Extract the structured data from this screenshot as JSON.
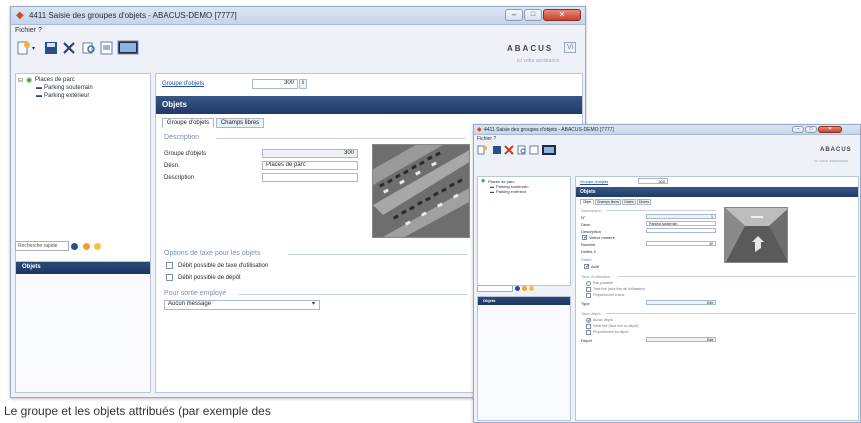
{
  "window1": {
    "title": "4411 Saisie des groupes d'objets - ABACUS-DEMO [7777]",
    "menu": "Fichier  ?",
    "brand": "ABACUS",
    "brand_suffix": "Vi",
    "help_link": "Ici votre assistance",
    "tree": {
      "root": "Places de parc",
      "children": [
        "Parking souterrain",
        "Parking extérieur"
      ]
    },
    "search_placeholder": "Recherche rapide",
    "objects_panel_title": "Objets",
    "group_field_label": "Groupe d'objets",
    "group_field_value": "300",
    "section_title": "Objets",
    "tabs": [
      "Groupe d'objets",
      "Champs libres"
    ],
    "description_group": "Description",
    "fields": [
      {
        "label": "Groupe d'objets",
        "value": "300"
      },
      {
        "label": "Désn.",
        "value": "Places de parc"
      },
      {
        "label": "Description",
        "value": ""
      }
    ],
    "tax_options_group": "Options de taxe pour les objets",
    "checkboxes": [
      "Débit possible de taxe d'utilisation",
      "Débit possible de dépôt"
    ],
    "exit_group": "Pour sortie employé",
    "exit_value": "Aucun message"
  },
  "window2": {
    "title": "4411 Saisie des groupes d'objets - ABACUS-DEMO [7777]",
    "menu": "Fichier  ?",
    "brand": "ABACUS",
    "help_link": "Ici votre assistance",
    "tree": {
      "root": "Places de parc",
      "children": [
        "Parking souterrain",
        "Parking extérieur"
      ]
    },
    "objects_panel_title": "Objets",
    "group_field_label": "Groupe d'objets",
    "group_field_value": "300",
    "section_title": "Objets",
    "tabs": [
      "Objet",
      "Champs libres",
      "Dates",
      "Divers"
    ],
    "description_group": "Description",
    "fields": [
      {
        "label": "N°",
        "value": "1"
      },
      {
        "label": "Désn.",
        "value": "Parking souterrain"
      },
      {
        "label": "Description",
        "value": ""
      },
      {
        "label": "Valeur nombre",
        "value": ""
      },
      {
        "label": "Nombre",
        "value": "40"
      },
      {
        "label": "Unités 4",
        "value": ""
      }
    ],
    "status_group": "Statut",
    "status_active": "Actif",
    "usage_group": "Taxe d'utilisation",
    "usage_options": [
      "Pas possible",
      "Taxe fixe (taux fixe de l'utilisateur)",
      "Proportionnel à taux"
    ],
    "usage_type_label": "Type",
    "usage_type_value": "Edit",
    "deposit_group": "Taxe dépôt",
    "deposit_options": [
      "Aucun dépôt",
      "Débit fixe (taux fixe du dépôt)",
      "Proportionnel au dépôt"
    ],
    "deposit_label": "Dépôt",
    "deposit_value": "Edit"
  },
  "caption": "Le groupe et les objets attribués (par exemple des"
}
